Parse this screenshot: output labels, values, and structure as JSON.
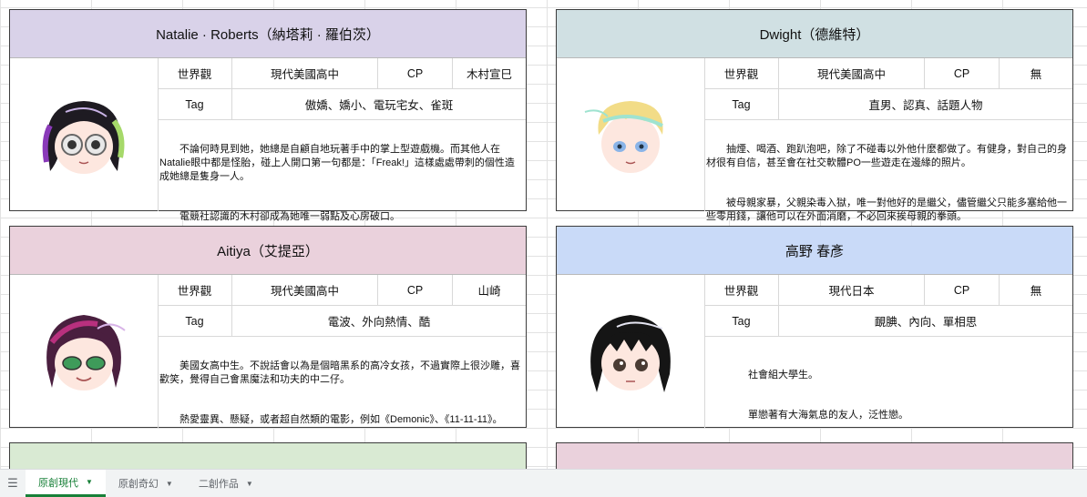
{
  "labels": {
    "world": "世界觀",
    "cp": "CP",
    "tag": "Tag"
  },
  "cards": [
    {
      "name": "Natalie · Roberts（納塔莉 · 羅伯茨）",
      "header_color": "#d9d2e9",
      "world": "現代美國高中",
      "cp": "木村宣巳",
      "tags": "傲嬌、嬌小、電玩宅女、雀斑",
      "desc": [
        "　　不論何時見到她，她總是自顧自地玩著手中的掌上型遊戲機。而其他人在Natalie眼中都是怪胎，碰上人開口第一句都是：「Freak!」這樣處處帶刺的個性造成她總是隻身一人。",
        "　　電競社認識的木村卻成為她唯一弱點及心房破口。"
      ]
    },
    {
      "name": "Dwight（德維特）",
      "header_color": "#d0e0e3",
      "world": "現代美國高中",
      "cp": "無",
      "tags": "直男、認真、話題人物",
      "desc": [
        "　　抽煙、喝酒、跑趴泡吧，除了不碰毒以外他什麼都做了。有健身，對自己的身材很有自信，甚至會在社交軟體PO一些遊走在邊緣的照片。",
        "　　被母親家暴，父親染毒入獄，唯一對他好的是繼父，儘管繼父只能多塞給他一些零用錢，讓他可以在外面消磨，不必回來挨母親的拳頭。"
      ]
    },
    {
      "name": "Aitiya（艾提亞）",
      "header_color": "#ead1dc",
      "world": "現代美國高中",
      "cp": "山崎",
      "tags": "電波、外向熱情、酷",
      "desc": [
        "　　美國女高中生。不說話會以為是個暗黑系的高冷女孩，不過實際上很沙雕，喜歡笑，覺得自己會黑魔法和功夫的中二仔。",
        "　　熱愛靈異、懸疑，或者超自然類的電影，例如《Demonic》、《11-11-11》。"
      ]
    },
    {
      "name": "高野 春彥",
      "header_color": "#c9daf8",
      "world": "現代日本",
      "cp": "無",
      "tags": "靦腆、內向、單相思",
      "desc": [
        "　　社會組大學生。",
        "　　單戀著有大海氣息的友人，泛性戀。"
      ]
    }
  ],
  "next_headers": [
    "#d9ead3",
    "#ead1dc"
  ],
  "tabs": [
    {
      "label": "原創現代",
      "active": true
    },
    {
      "label": "原創奇幻",
      "active": false
    },
    {
      "label": "二創作品",
      "active": false
    }
  ],
  "icons": {
    "menu": "hamburger-menu-icon",
    "caret": "dropdown-caret-icon"
  }
}
